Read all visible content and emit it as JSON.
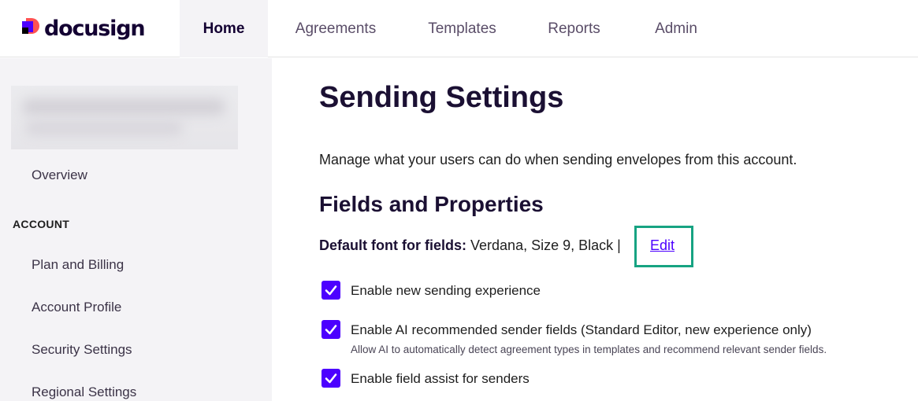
{
  "brand": {
    "name": "docusign",
    "colors": {
      "primary": "#4c00ff",
      "accent": "#ff5252",
      "highlight": "#17a382"
    }
  },
  "nav": {
    "items": [
      {
        "label": "Home",
        "active": true
      },
      {
        "label": "Agreements",
        "active": false
      },
      {
        "label": "Templates",
        "active": false
      },
      {
        "label": "Reports",
        "active": false
      },
      {
        "label": "Admin",
        "active": false
      }
    ]
  },
  "sidebar": {
    "overview": "Overview",
    "section": "ACCOUNT",
    "items": [
      "Plan and Billing",
      "Account Profile",
      "Security Settings",
      "Regional Settings"
    ]
  },
  "main": {
    "title": "Sending Settings",
    "description": "Manage what your users can do when sending envelopes from this account.",
    "section_title": "Fields and Properties",
    "default_font_label": "Default font for fields:",
    "default_font_value": "Verdana, Size 9, Black",
    "separator": "|",
    "edit_label": "Edit",
    "options": [
      {
        "label": "Enable new sending experience",
        "checked": true
      },
      {
        "label": "Enable AI recommended sender fields (Standard Editor, new experience only)",
        "checked": true,
        "help": "Allow AI to automatically detect agreement types in templates and recommend relevant sender fields."
      },
      {
        "label": "Enable field assist for senders",
        "checked": true
      }
    ]
  }
}
